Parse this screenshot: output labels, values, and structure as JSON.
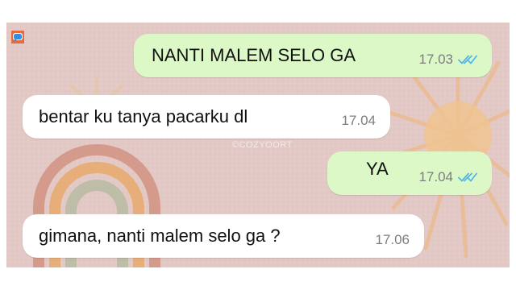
{
  "watermark": "©COZYOORT",
  "messages": [
    {
      "direction": "outgoing",
      "text": "NANTI MALEM SELO GA",
      "time": "17.03",
      "status_icon": "double-check-read-icon"
    },
    {
      "direction": "incoming",
      "text": "bentar ku tanya pacarku dl",
      "time": "17.04"
    },
    {
      "direction": "outgoing",
      "text": "YA",
      "time": "17.04",
      "status_icon": "double-check-read-icon"
    },
    {
      "direction": "incoming",
      "text": "gimana, nanti malem selo ga ?",
      "time": "17.06"
    }
  ],
  "colors": {
    "outgoing_bubble": "#dcf8c6",
    "incoming_bubble": "#ffffff",
    "wallpaper": "#e3c9c6",
    "read_ticks": "#4fb6ec"
  }
}
